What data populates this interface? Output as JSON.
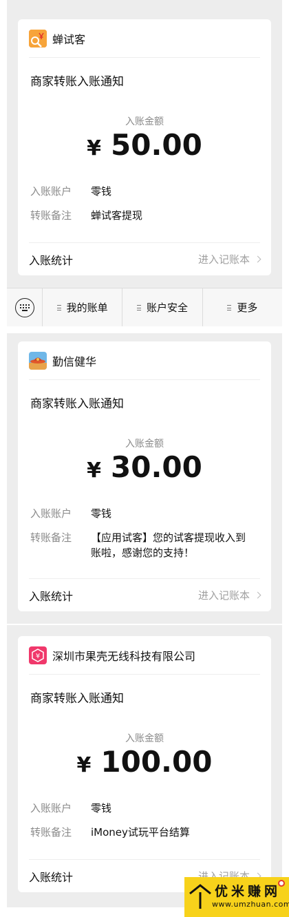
{
  "notifications": [
    {
      "merchant": "蝉试客",
      "notice_title": "商家转账入账通知",
      "amount_label": "入账金额",
      "currency": "¥",
      "amount": "50.00",
      "account_label": "入账账户",
      "account_value": "零钱",
      "remark_label": "转账备注",
      "remark_value": "蝉试客提现",
      "stats_label": "入账统计",
      "ledger_link": "进入记账本"
    },
    {
      "merchant": "勤信健华",
      "notice_title": "商家转账入账通知",
      "amount_label": "入账金额",
      "currency": "¥",
      "amount": "30.00",
      "account_label": "入账账户",
      "account_value": "零钱",
      "remark_label": "转账备注",
      "remark_line1": "【应用试客】您的试客提现收入到",
      "remark_line2": "账啦，感谢您的支持！",
      "stats_label": "入账统计",
      "ledger_link": "进入记账本"
    },
    {
      "merchant": "深圳市果壳无线科技有限公司",
      "notice_title": "商家转账入账通知",
      "amount_label": "入账金额",
      "currency": "¥",
      "amount": "100.00",
      "account_label": "入账账户",
      "account_value": "零钱",
      "remark_label": "转账备注",
      "remark_value": "iMoney试玩平台结算",
      "stats_label": "入账统计",
      "ledger_link": "进入记账本"
    }
  ],
  "menu": {
    "items": [
      "我的账单",
      "账户安全",
      "更多"
    ]
  },
  "watermark": {
    "title": "优米赚网",
    "url": "www.umzhuan.com"
  },
  "colors": {
    "panel_bg": "#ededed",
    "logo1": "#f5882a",
    "logo3": "#f0386b",
    "watermark": "#f7d21b"
  },
  "icons": [
    "keyboard-icon",
    "menu-lines-icon",
    "chevron-right-icon",
    "merchant-logo-icon",
    "house-roof-icon"
  ]
}
